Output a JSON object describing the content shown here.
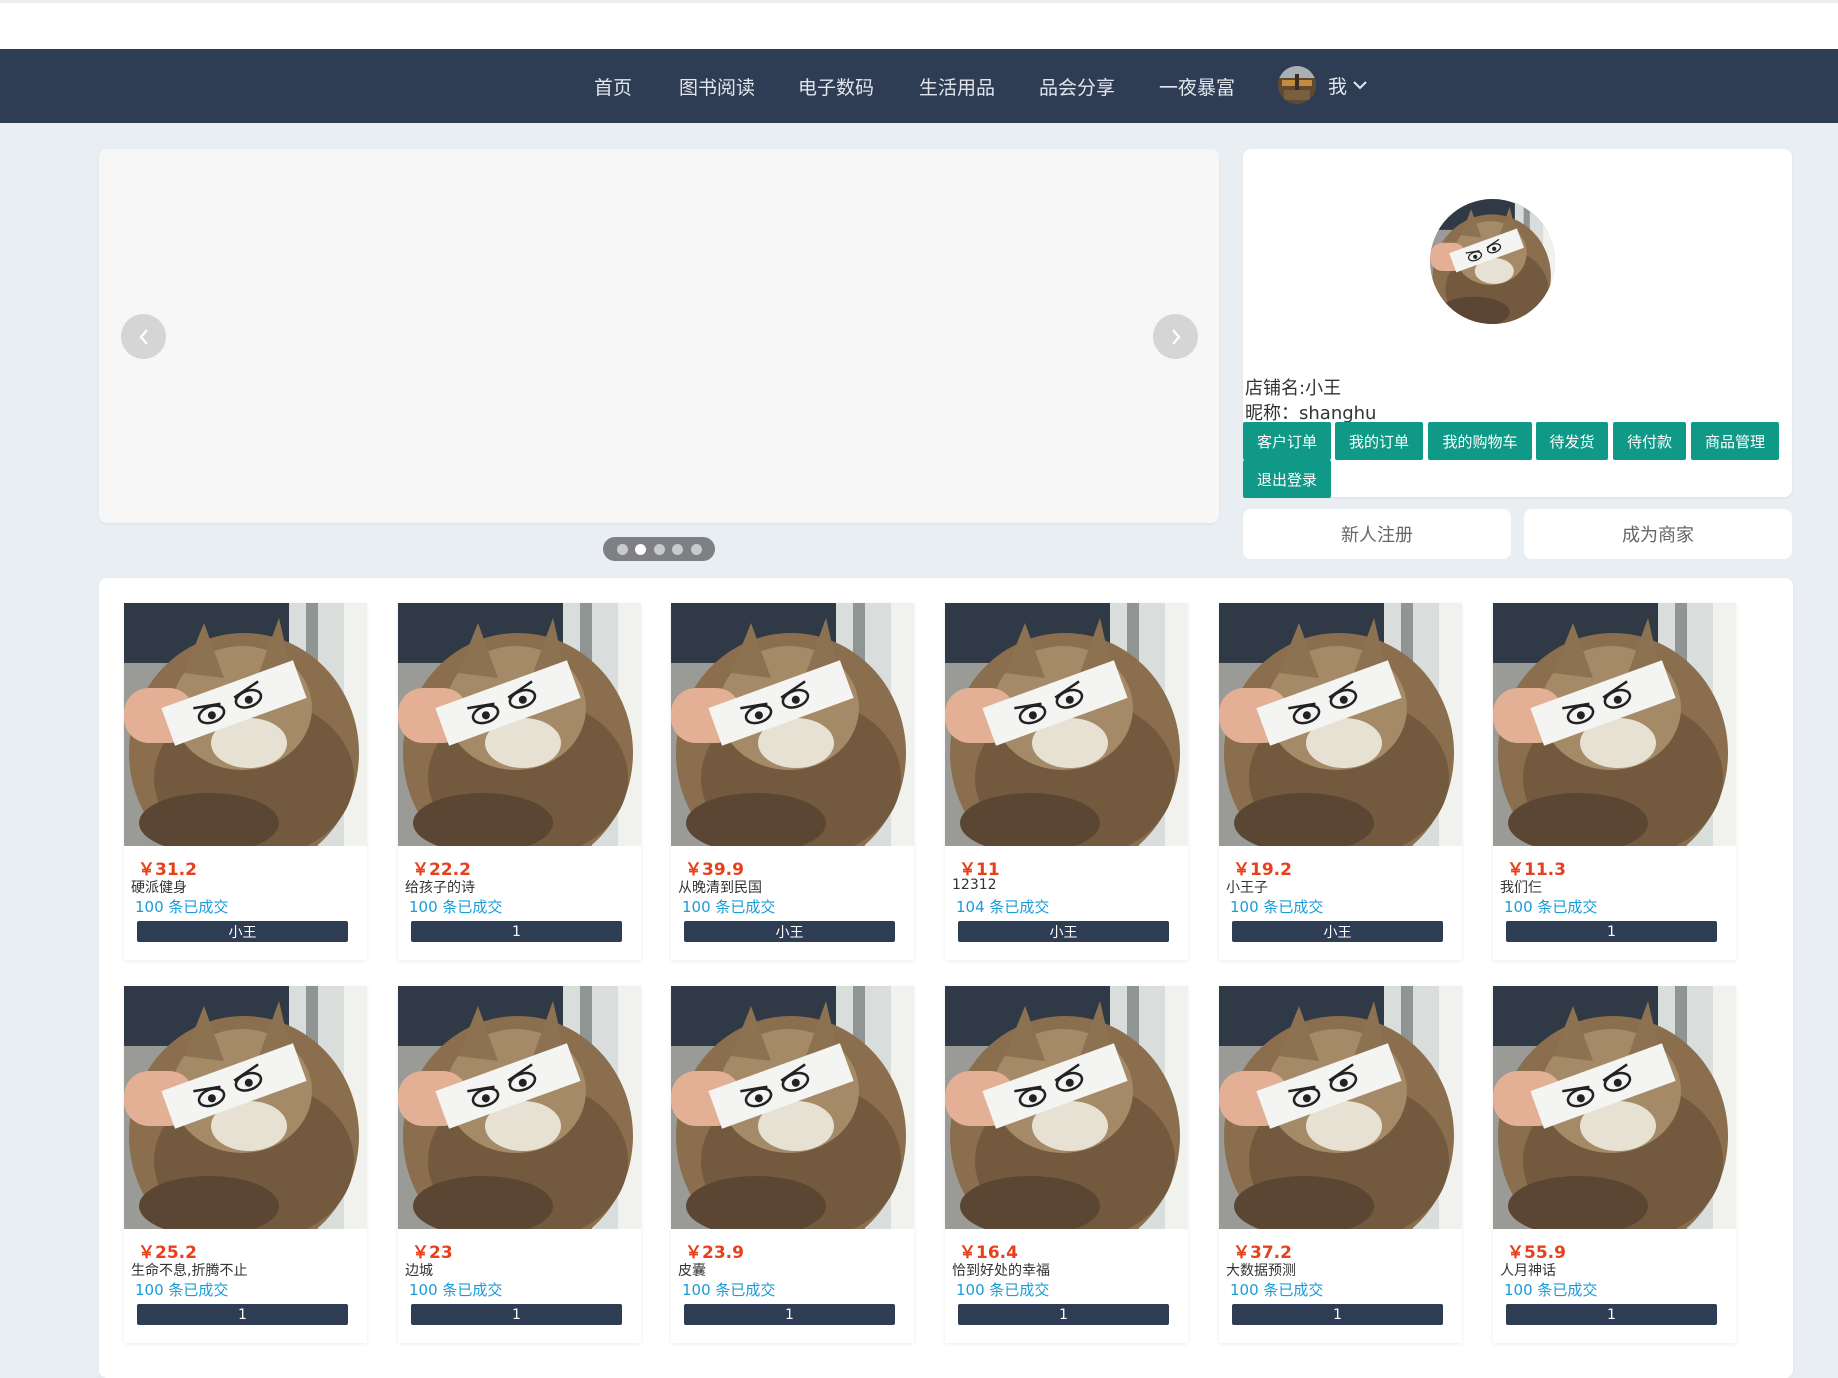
{
  "nav": {
    "items": [
      "首页",
      "图书阅读",
      "电子数码",
      "生活用品",
      "品会分享",
      "一夜暴富"
    ],
    "user_label": "我",
    "avatar_icon": "user-avatar-image",
    "chevron_icon": "chevron-down-icon"
  },
  "carousel": {
    "prev_icon": "chevron-left-icon",
    "next_icon": "chevron-right-icon",
    "dots": 5,
    "active_dot": 1
  },
  "profile": {
    "shop_name": "店铺名:小王",
    "nickname": "昵称：shanghu",
    "buttons": [
      "客户订单",
      "我的订单",
      "我的购物车",
      "待发货",
      "待付款",
      "商品管理",
      "退出登录"
    ]
  },
  "actions": {
    "register": "新人注册",
    "become_merchant": "成为商家"
  },
  "products": [
    {
      "price": "￥31.2",
      "name": "硬派健身",
      "sold": "100 条已成交",
      "seller": "小王"
    },
    {
      "price": "￥22.2",
      "name": "给孩子的诗",
      "sold": "100 条已成交",
      "seller": "1"
    },
    {
      "price": "￥39.9",
      "name": "从晚清到民国",
      "sold": "100 条已成交",
      "seller": "小王"
    },
    {
      "price": "￥11",
      "name": "12312",
      "sold": "104 条已成交",
      "seller": "小王"
    },
    {
      "price": "￥19.2",
      "name": "小王子",
      "sold": "100 条已成交",
      "seller": "小王"
    },
    {
      "price": "￥11.3",
      "name": "我们仨",
      "sold": "100 条已成交",
      "seller": "1"
    },
    {
      "price": "￥25.2",
      "name": "生命不息,折腾不止",
      "sold": "100 条已成交",
      "seller": "1"
    },
    {
      "price": "￥23",
      "name": "边城",
      "sold": "100 条已成交",
      "seller": "1"
    },
    {
      "price": "￥23.9",
      "name": "皮囊",
      "sold": "100 条已成交",
      "seller": "1"
    },
    {
      "price": "￥16.4",
      "name": "恰到好处的幸福",
      "sold": "100 条已成交",
      "seller": "1"
    },
    {
      "price": "￥37.2",
      "name": "大数据预测",
      "sold": "100 条已成交",
      "seller": "1"
    },
    {
      "price": "￥55.9",
      "name": "人月神话",
      "sold": "100 条已成交",
      "seller": "1"
    }
  ],
  "product_image_icon": "cat-photo-image"
}
